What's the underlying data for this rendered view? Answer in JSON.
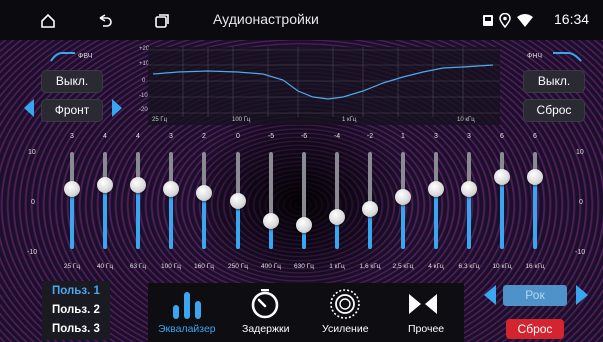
{
  "status_bar": {
    "title": "Аудионастройки",
    "time": "16:34",
    "icons": [
      "home-icon",
      "back-icon",
      "recent-apps-icon",
      "sd-card-icon",
      "location-icon",
      "wifi-icon"
    ]
  },
  "hpf": {
    "label": "ФВЧ",
    "state_button": "Выкл.",
    "zone_select": "Фронт"
  },
  "lpf": {
    "label": "ФНЧ",
    "state_button": "Выкл.",
    "reset_button": "Сброс"
  },
  "graph": {
    "y_labels": [
      "+20",
      "+10",
      "0",
      "-10",
      "-20"
    ],
    "x_labels": [
      "25 Гц",
      "100 Гц",
      "1 кГц",
      "10 кГц"
    ]
  },
  "eq": {
    "scale": {
      "top": "10",
      "mid": "0",
      "bottom": "-10"
    },
    "bands": [
      {
        "freq": "25 Гц",
        "value": "3",
        "level": 3
      },
      {
        "freq": "40 Гц",
        "value": "4",
        "level": 4
      },
      {
        "freq": "63 Гц",
        "value": "4",
        "level": 4
      },
      {
        "freq": "100 Гц",
        "value": "3",
        "level": 3
      },
      {
        "freq": "160 Гц",
        "value": "2",
        "level": 2
      },
      {
        "freq": "250 Гц",
        "value": "0",
        "level": 0
      },
      {
        "freq": "400 Гц",
        "value": "-5",
        "level": -5
      },
      {
        "freq": "630 Гц",
        "value": "-6",
        "level": -6
      },
      {
        "freq": "1 кГц",
        "value": "-4",
        "level": -4
      },
      {
        "freq": "1,6 кГц",
        "value": "-2",
        "level": -2
      },
      {
        "freq": "2,5 кГц",
        "value": "1",
        "level": 1
      },
      {
        "freq": "4 кГц",
        "value": "3",
        "level": 3
      },
      {
        "freq": "6,3 кГц",
        "value": "3",
        "level": 3
      },
      {
        "freq": "10 кГц",
        "value": "6",
        "level": 6
      },
      {
        "freq": "16 кГц",
        "value": "6",
        "level": 6
      }
    ]
  },
  "presets": {
    "items": [
      "Польз. 1",
      "Польз. 2",
      "Польз. 3"
    ],
    "active_index": 0
  },
  "nav": {
    "items": [
      {
        "label": "Эквалайзер",
        "icon": "equalizer-icon",
        "active": true
      },
      {
        "label": "Задержки",
        "icon": "timer-icon",
        "active": false
      },
      {
        "label": "Усиление",
        "icon": "loudness-icon",
        "active": false
      },
      {
        "label": "Прочее",
        "icon": "bowtie-icon",
        "active": false
      }
    ]
  },
  "preset_style": {
    "selected": "Рок",
    "reset_button": "Сброс"
  },
  "colors": {
    "accent": "#3aa6f0",
    "reset_red": "#d3242f",
    "status_bg": "#0a0a0f"
  }
}
